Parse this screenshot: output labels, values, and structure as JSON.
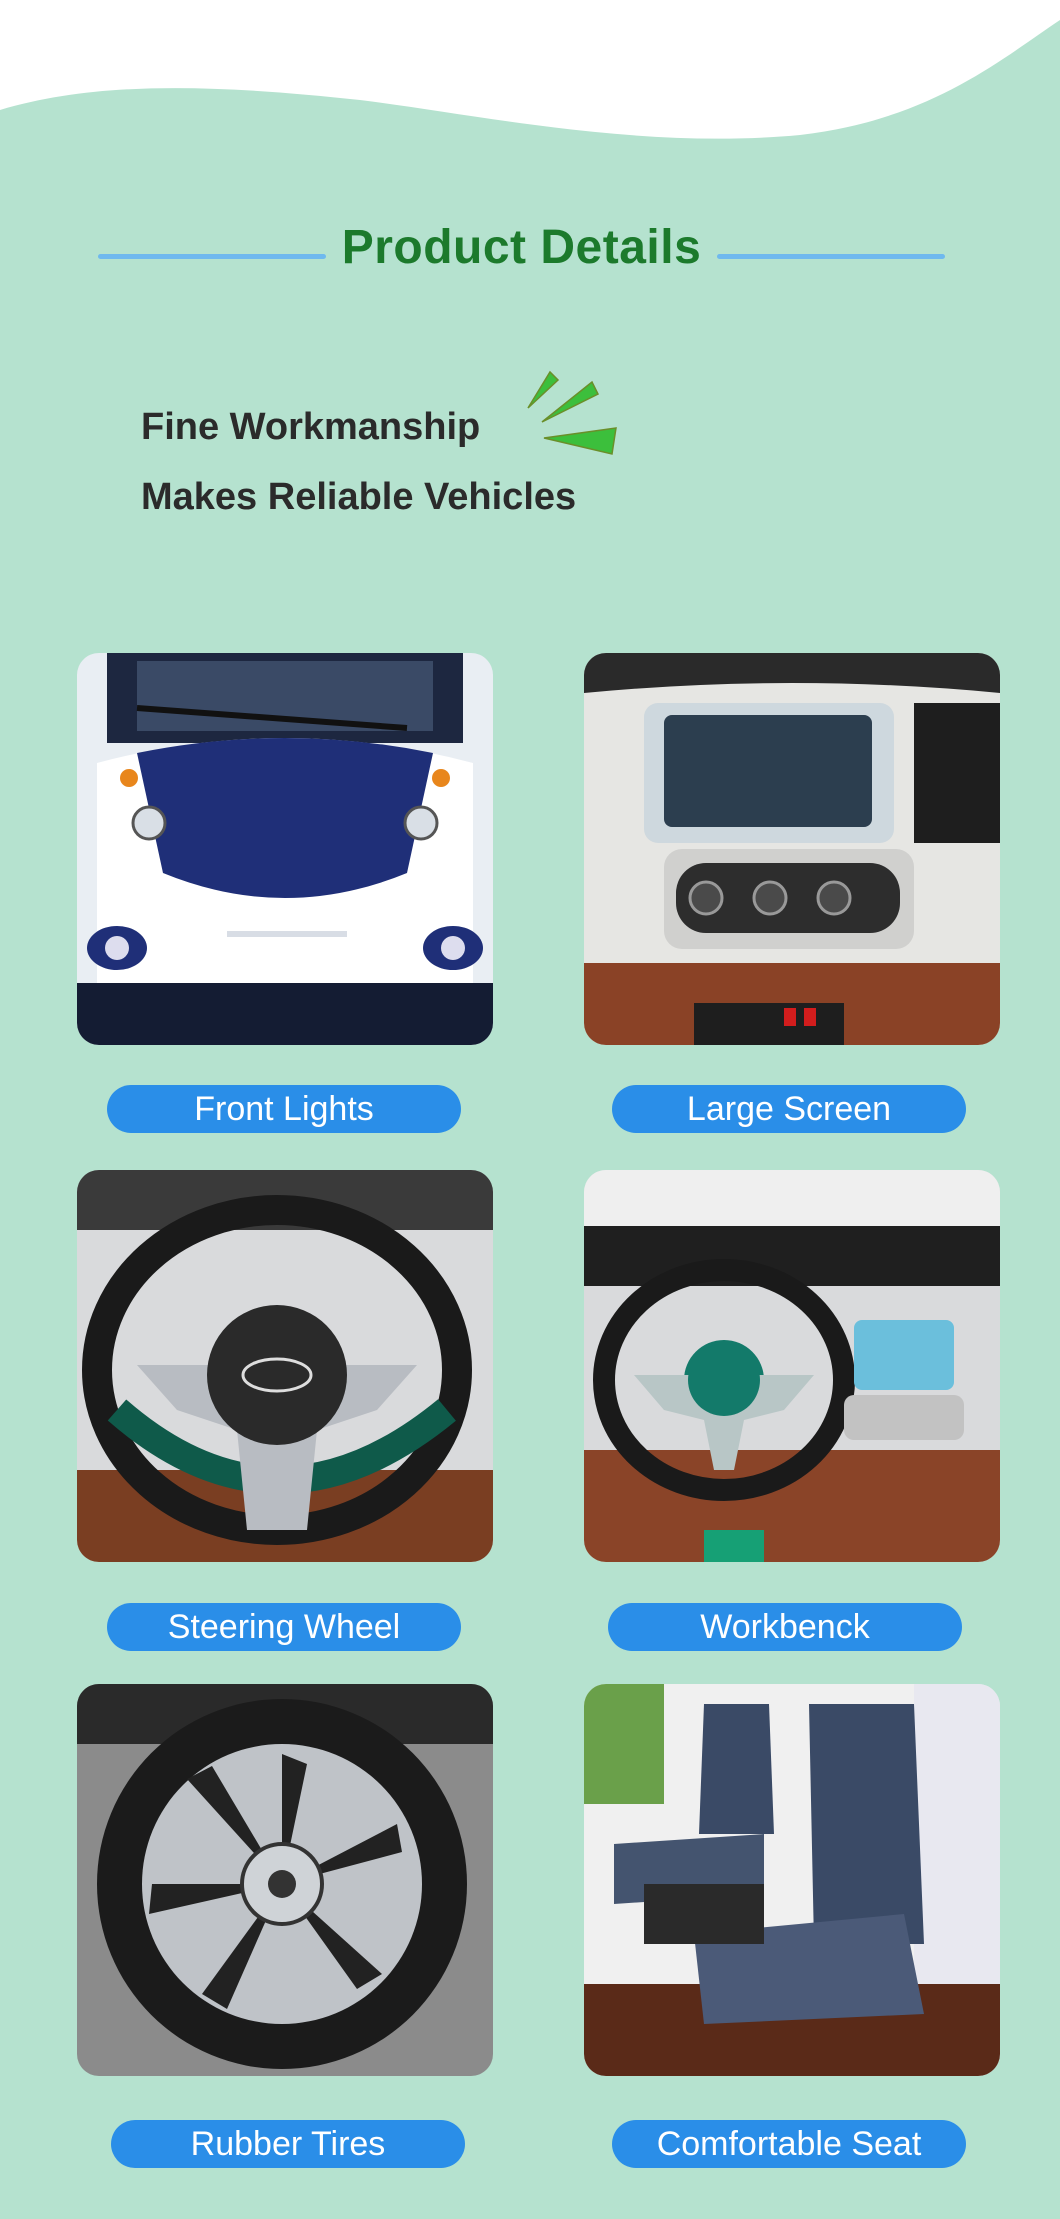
{
  "header": {
    "title": "Product Details",
    "tagline_line1": "Fine Workmanship",
    "tagline_line2": "Makes Reliable Vehicles"
  },
  "features": [
    {
      "label": "Front Lights",
      "image": "front-lights-photo"
    },
    {
      "label": "Large Screen",
      "image": "large-screen-photo"
    },
    {
      "label": "Steering Wheel",
      "image": "steering-wheel-photo"
    },
    {
      "label": "Workbenck",
      "image": "workbench-photo"
    },
    {
      "label": "Rubber Tires",
      "image": "rubber-tires-photo"
    },
    {
      "label": "Comfortable Seat",
      "image": "comfortable-seat-photo"
    }
  ],
  "colors": {
    "background": "#b5e2cf",
    "title": "#1c7a2c",
    "accent_line": "#6fb9ee",
    "pill": "#2a8ee8",
    "burst": "#3cbf3c"
  }
}
